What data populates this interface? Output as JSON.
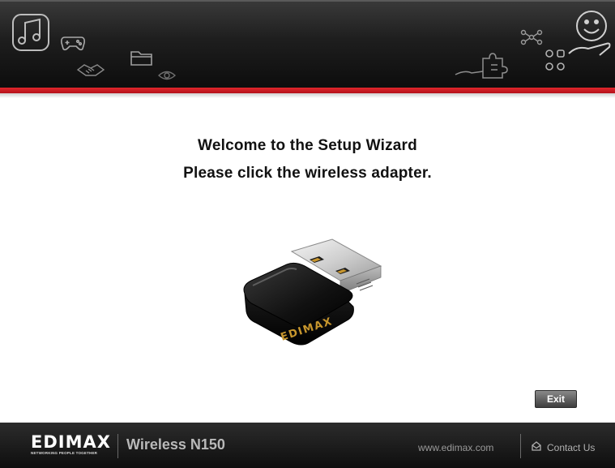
{
  "header": {
    "decorative_icons": [
      "music-icon",
      "gamepad-icon",
      "handshake-icon",
      "folder-icon",
      "eye-icon",
      "network-icon",
      "puzzle-icon",
      "smile-icon",
      "dots-icon"
    ]
  },
  "main": {
    "title": "Welcome to the Setup Wizard",
    "subtitle": "Please click the wireless adapter.",
    "adapter_brand": "EDIMAX",
    "exit_label": "Exit"
  },
  "footer": {
    "logo": "EDIMAX",
    "tagline": "NETWORKING PEOPLE TOGETHER",
    "product": "Wireless N150",
    "website": "www.edimax.com",
    "contact": "Contact Us"
  },
  "colors": {
    "accent_red": "#d81f26",
    "header_dark": "#1e1e1e",
    "footer_dark": "#1a1a1a"
  }
}
